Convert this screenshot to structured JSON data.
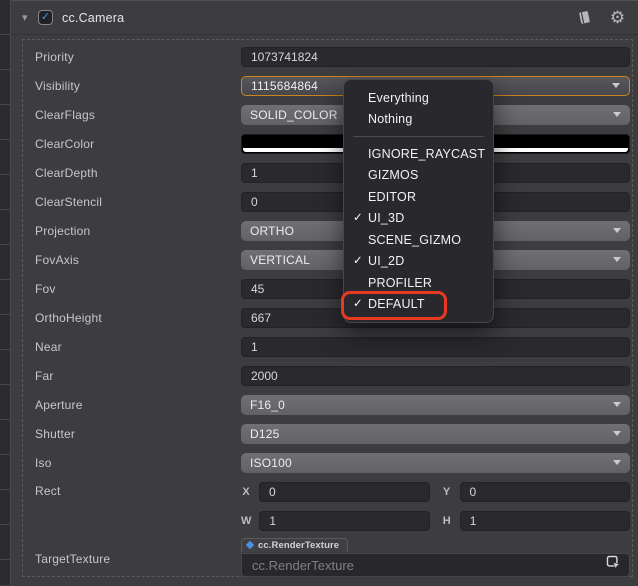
{
  "header": {
    "title": "cc.Camera",
    "enabled_checkbox": {
      "checked": true,
      "check_glyph": "✓"
    },
    "collapse_arrow_glyph": "▾",
    "icons": {
      "docs": "book-icon",
      "settings": "gear-icon"
    }
  },
  "colors": {
    "accent_orange": "#c9851f",
    "highlight_red": "#e63b22",
    "checkbox_blue": "#4a8fe2",
    "clear_color_value": "#000000",
    "clear_color_alpha_bar": "#ffffff"
  },
  "rows": [
    {
      "label": "Priority",
      "type": "input",
      "value": "1073741824"
    },
    {
      "label": "Visibility",
      "type": "select",
      "value": "1115684864",
      "focused": true
    },
    {
      "label": "ClearFlags",
      "type": "select",
      "value": "SOLID_COLOR"
    },
    {
      "label": "ClearColor",
      "type": "color",
      "value": "#000000"
    },
    {
      "label": "ClearDepth",
      "type": "input",
      "value": "1"
    },
    {
      "label": "ClearStencil",
      "type": "input",
      "value": "0"
    },
    {
      "label": "Projection",
      "type": "select",
      "value": "ORTHO"
    },
    {
      "label": "FovAxis",
      "type": "select",
      "value": "VERTICAL"
    },
    {
      "label": "Fov",
      "type": "input",
      "value": "45"
    },
    {
      "label": "OrthoHeight",
      "type": "input",
      "value": "667"
    },
    {
      "label": "Near",
      "type": "input",
      "value": "1"
    },
    {
      "label": "Far",
      "type": "input",
      "value": "2000"
    },
    {
      "label": "Aperture",
      "type": "select",
      "value": "F16_0"
    },
    {
      "label": "Shutter",
      "type": "select",
      "value": "D125"
    },
    {
      "label": "Iso",
      "type": "select",
      "value": "ISO100"
    },
    {
      "label": "Rect",
      "type": "rect",
      "fields": [
        {
          "axis": "X",
          "value": "0"
        },
        {
          "axis": "Y",
          "value": "0"
        },
        {
          "axis": "W",
          "value": "1"
        },
        {
          "axis": "H",
          "value": "1"
        }
      ]
    },
    {
      "label": "TargetTexture",
      "type": "asset",
      "tag": "cc.RenderTexture",
      "placeholder": "cc.RenderTexture"
    }
  ],
  "menu": {
    "check_glyph": "✓",
    "items": [
      {
        "label": "Everything",
        "checked": false
      },
      {
        "label": "Nothing",
        "checked": false,
        "divider_after": true
      },
      {
        "label": "IGNORE_RAYCAST",
        "checked": false
      },
      {
        "label": "GIZMOS",
        "checked": false
      },
      {
        "label": "EDITOR",
        "checked": false
      },
      {
        "label": "UI_3D",
        "checked": true
      },
      {
        "label": "SCENE_GIZMO",
        "checked": false
      },
      {
        "label": "UI_2D",
        "checked": true
      },
      {
        "label": "PROFILER",
        "checked": false
      },
      {
        "label": "DEFAULT",
        "checked": true,
        "highlighted": true
      }
    ]
  }
}
